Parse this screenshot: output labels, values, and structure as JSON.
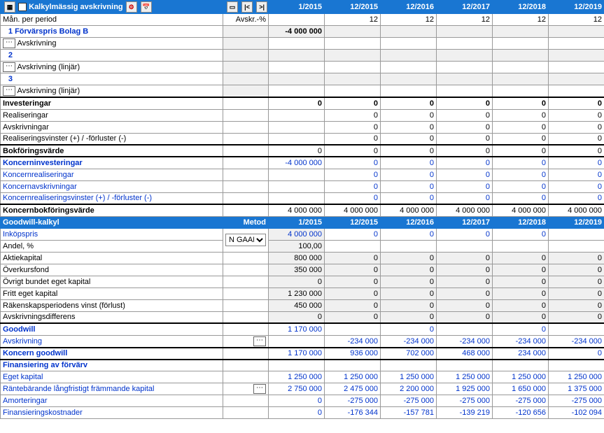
{
  "periods": [
    "1/2015",
    "12/2015",
    "12/2016",
    "12/2017",
    "12/2018",
    "12/2019"
  ],
  "header": {
    "title": "Kalkylmässig avskrivning",
    "man_per_period": "Mån. per period",
    "avskr_pct": "Avskr.-%",
    "man_values": [
      "",
      "12",
      "12",
      "12",
      "12",
      "12"
    ]
  },
  "dep_rows": {
    "r1_label": "Förvärspris Bolag B",
    "r1_num": "1",
    "r1_v0": "-4 000 000",
    "avskrivning": "Avskrivning",
    "r2_num": "2",
    "avskrivning_linjar": "Avskrivning (linjär)",
    "r3_num": "3"
  },
  "summary1": {
    "investeringar": "Investeringar",
    "realiseringar": "Realiseringar",
    "avskrivningar": "Avskrivningar",
    "realvinster": "Realiseringsvinster (+) / -förluster (-)",
    "bokforingsvarde": "Bokföringsvärde",
    "inv_v": [
      "0",
      "0",
      "0",
      "0",
      "0",
      "0"
    ],
    "real_v": [
      "0",
      "0",
      "0",
      "0",
      "0"
    ],
    "avsk_v": [
      "0",
      "0",
      "0",
      "0",
      "0"
    ],
    "rvf_v": [
      "0",
      "0",
      "0",
      "0",
      "0"
    ],
    "bok_v": [
      "0",
      "0",
      "0",
      "0",
      "0",
      "0"
    ]
  },
  "koncern": {
    "investeringar": "Koncerninvesteringar",
    "realiseringar": "Koncernrealiseringar",
    "avskrivningar": "Koncernavskrivningar",
    "realvinster": "Koncernrealiseringsvinster (+) / -förluster (-)",
    "bokforingsvarde": "Koncernbokföringsvärde",
    "inv_v": [
      "-4 000 000",
      "0",
      "0",
      "0",
      "0",
      "0"
    ],
    "real_v": [
      "0",
      "0",
      "0",
      "0",
      "0"
    ],
    "avsk_v": [
      "0",
      "0",
      "0",
      "0",
      "0"
    ],
    "rvf_v": [
      "0",
      "0",
      "0",
      "0",
      "0"
    ],
    "bok_v": [
      "4 000 000",
      "4 000 000",
      "4 000 000",
      "4 000 000",
      "4 000 000",
      "4 000 000"
    ]
  },
  "goodwill": {
    "title": "Goodwill-kalkyl",
    "metod": "Metod",
    "metod_val": "N GAAP",
    "inkopspris": "Inköpspris",
    "inkopspris_v": [
      "4 000 000",
      "0",
      "0",
      "0",
      "0"
    ],
    "andel": "Andel, %",
    "andel_v": "100,00",
    "aktiekapital": "Aktiekapital",
    "aktiekapital_v": [
      "800 000",
      "0",
      "0",
      "0",
      "0",
      "0"
    ],
    "overkursfond": "Överkursfond",
    "overkursfond_v": [
      "350 000",
      "0",
      "0",
      "0",
      "0",
      "0"
    ],
    "ovrigt": "Övrigt bundet eget kapital",
    "ovrigt_v": [
      "0",
      "0",
      "0",
      "0",
      "0",
      "0"
    ],
    "fritt": "Fritt eget kapital",
    "fritt_v": [
      "1 230 000",
      "0",
      "0",
      "0",
      "0",
      "0"
    ],
    "rakenskap": "Räkenskapsperiodens vinst (förlust)",
    "rakenskap_v": [
      "450 000",
      "0",
      "0",
      "0",
      "0",
      "0"
    ],
    "avskrdiff": "Avskrivningsdifferens",
    "avskrdiff_v": [
      "0",
      "0",
      "0",
      "0",
      "0",
      "0"
    ],
    "goodwill_lbl": "Goodwill",
    "goodwill_v": [
      "1 170 000",
      "",
      "0",
      "",
      "0",
      ""
    ],
    "avskrivning": "Avskrivning",
    "avskrivning_v": [
      "",
      "-234 000",
      "-234 000",
      "-234 000",
      "-234 000",
      "-234 000"
    ],
    "koncern_gw": "Koncern goodwill",
    "koncern_gw_v": [
      "1 170 000",
      "936 000",
      "702 000",
      "468 000",
      "234 000",
      "0"
    ]
  },
  "finans": {
    "title": "Finansiering av förvärv",
    "eget": "Eget kapital",
    "eget_v": [
      "1 250 000",
      "1 250 000",
      "1 250 000",
      "1 250 000",
      "1 250 000",
      "1 250 000"
    ],
    "rantebar": "Räntebärande långfristigt främmande kapital",
    "rantebar_v": [
      "2 750 000",
      "2 475 000",
      "2 200 000",
      "1 925 000",
      "1 650 000",
      "1 375 000"
    ],
    "amort": "Amorteringar",
    "amort_v": [
      "0",
      "-275 000",
      "-275 000",
      "-275 000",
      "-275 000",
      "-275 000"
    ],
    "finkost": "Finansieringskostnader",
    "finkost_v": [
      "0",
      "-176 344",
      "-157 781",
      "-139 219",
      "-120 656",
      "-102 094"
    ]
  }
}
